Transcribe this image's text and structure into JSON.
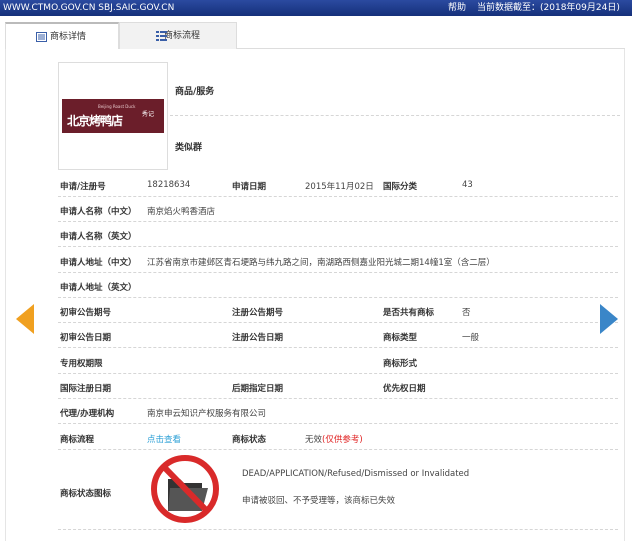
{
  "topbar": {
    "site": "WWW.CTMO.GOV.CN SBJ.SAIC.GOV.CN",
    "help": "帮助",
    "data_date": "当前数据截至：(2018年09月24日)"
  },
  "tabs": [
    {
      "label": "商标详情",
      "icon": "list-detail-icon"
    },
    {
      "label": "商标流程",
      "icon": "grid-list-icon"
    }
  ],
  "logo": {
    "text_cn": "北京烤鸭店",
    "text_en": "Beijing Roast Duck",
    "mark": "秀记"
  },
  "goods_label": "商品/服务",
  "similar_label": "类似群",
  "fields": {
    "reg_no_label": "申请/注册号",
    "reg_no": "18218634",
    "app_date_label": "申请日期",
    "app_date": "2015年11月02日",
    "intl_class_label": "国际分类",
    "intl_class": "43",
    "applicant_cn_label": "申请人名称（中文）",
    "applicant_cn": "南京焰火鸭香酒店",
    "applicant_en_label": "申请人名称（英文）",
    "address_cn_label": "申请人地址（中文）",
    "address_cn": "江苏省南京市建邺区青石埂路与纬九路之间，南湖路西侧嘉业阳光城二期14幢1室（含二层）",
    "address_en_label": "申请人地址（英文）",
    "prelim_no_label": "初审公告期号",
    "reg_pub_no_label": "注册公告期号",
    "shared_label": "是否共有商标",
    "shared": "否",
    "prelim_date_label": "初审公告日期",
    "reg_pub_date_label": "注册公告日期",
    "tm_type_label": "商标类型",
    "tm_type": "一般",
    "term_label": "专用权期限",
    "tm_form_label": "商标形式",
    "intl_reg_date_label": "国际注册日期",
    "later_date_label": "后期指定日期",
    "priority_date_label": "优先权日期",
    "agent_label": "代理/办理机构",
    "agent": "南京申云知识产权服务有限公司",
    "process_label": "商标流程",
    "process_link": "点击查看",
    "status_label": "商标状态",
    "status": "无效",
    "status_note": "(仅供参考)",
    "status_icon_label": "商标状态图标",
    "status_en": "DEAD/APPLICATION/Refused/Dismissed or Invalidated",
    "status_cn": "申请被驳回、不予受理等，该商标已失效"
  },
  "colors": {
    "topbar": "#1a3685",
    "arrow_left": "#f0a020",
    "arrow_right": "#3a86c8",
    "link": "#2a9fd6",
    "status_red": "#e02020"
  }
}
